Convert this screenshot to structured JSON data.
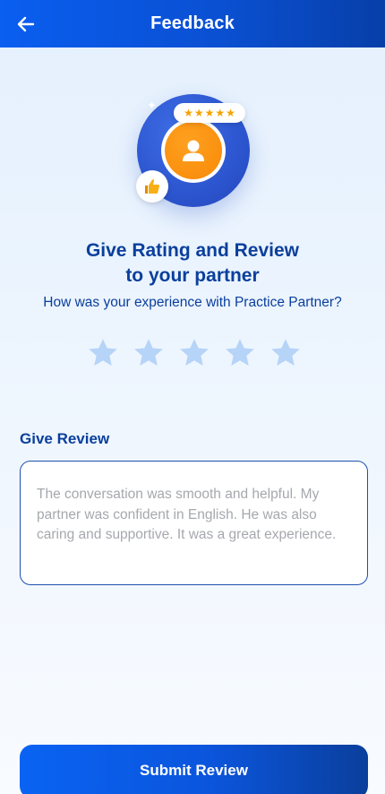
{
  "header": {
    "title": "Feedback",
    "back_icon": "arrow-left-icon",
    "background": "#0a5ef0"
  },
  "hero": {
    "avatar_icon": "user-icon",
    "badge_stars": [
      "★",
      "★",
      "★",
      "★",
      "★"
    ],
    "thumb_icon": "thumbs-up-icon",
    "ring_color": "#2c55cf",
    "avatar_color": "#f78a06",
    "star_color": "#f5a300"
  },
  "main": {
    "title_line1": "Give Rating and Review",
    "title_line2": "to your partner",
    "subtitle": "How was your experience with Practice Partner?"
  },
  "rating": {
    "max": 5,
    "value": 0,
    "empty_color": "#b6d3f8",
    "stars": [
      {
        "icon": "star-icon"
      },
      {
        "icon": "star-icon"
      },
      {
        "icon": "star-icon"
      },
      {
        "icon": "star-icon"
      },
      {
        "icon": "star-icon"
      }
    ]
  },
  "review": {
    "label": "Give Review",
    "value": "",
    "placeholder": "The conversation was smooth and helpful. My partner was confident in English. He was also caring and supportive. It was a great experience."
  },
  "submit": {
    "label": "Submit Review"
  },
  "colors": {
    "primary": "#0a5ef0",
    "heading": "#0a3f9c"
  }
}
